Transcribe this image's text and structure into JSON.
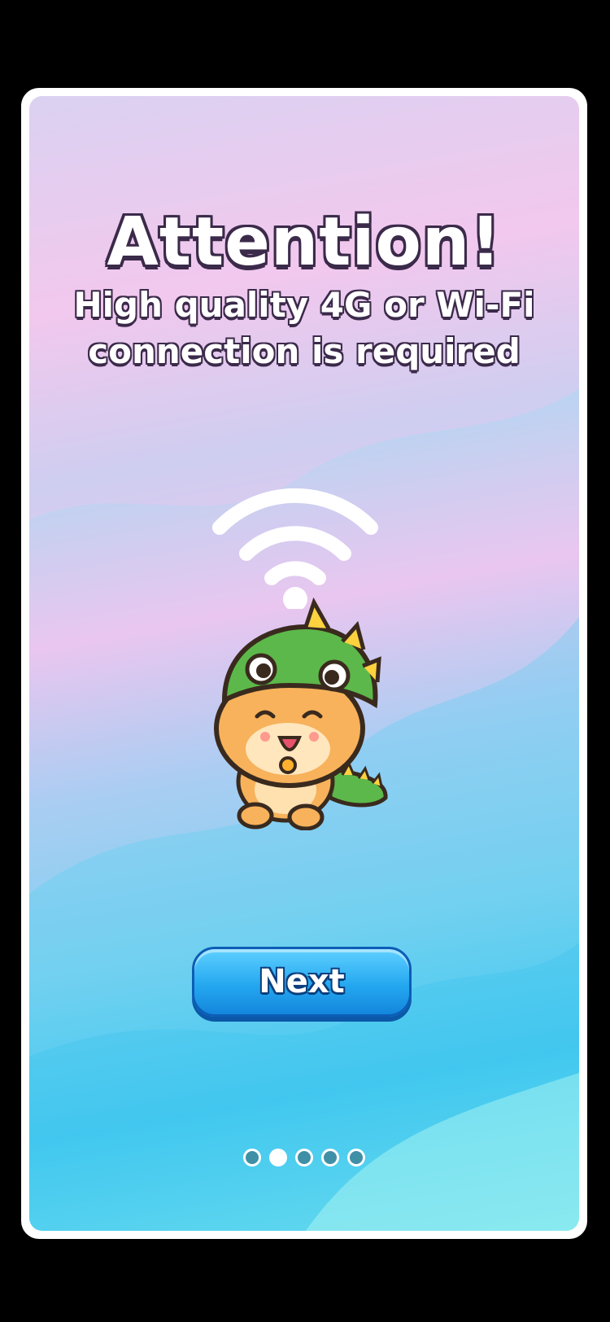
{
  "screen": {
    "title": "Attention!",
    "subtitle": "High quality 4G or Wi-Fi connection is required",
    "next_button_label": "Next"
  },
  "pagination": {
    "total": 5,
    "active_index": 1
  },
  "icons": {
    "wifi": "wifi-icon",
    "mascot": "dino-cat-mascot"
  },
  "colors": {
    "button_blue": "#25a8f0",
    "text_outline": "#3b2a4a",
    "dot_inactive": "#3f8fa6"
  }
}
